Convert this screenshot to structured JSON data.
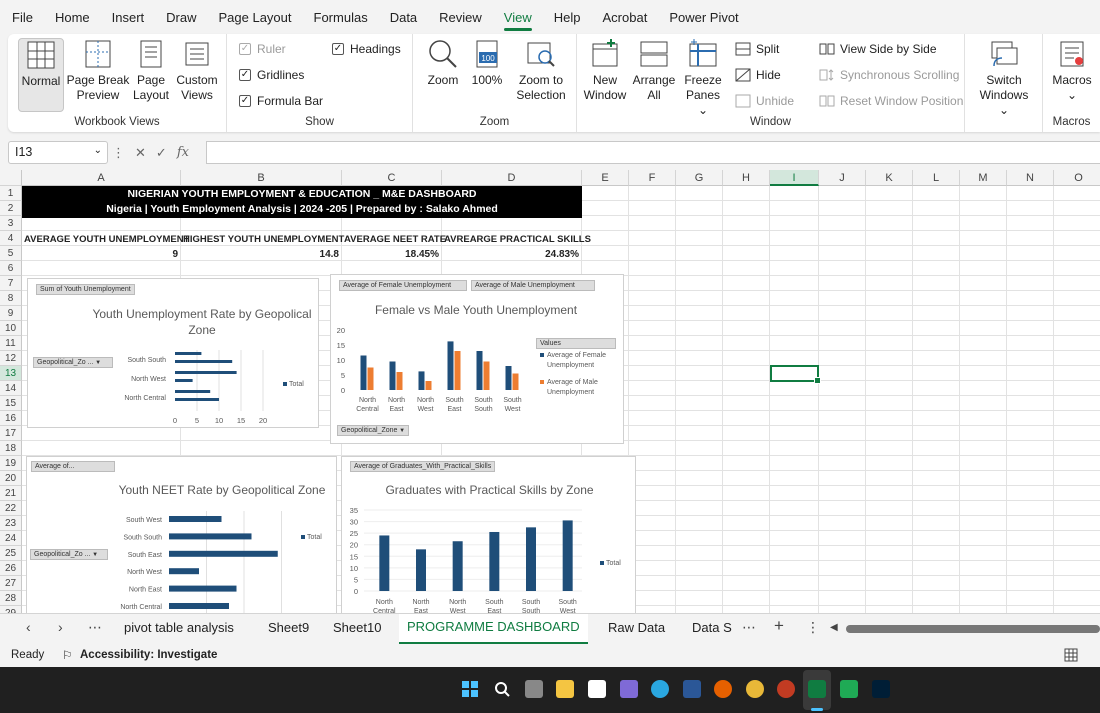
{
  "menu": [
    "File",
    "Home",
    "Insert",
    "Draw",
    "Page Layout",
    "Formulas",
    "Data",
    "Review",
    "View",
    "Help",
    "Acrobat",
    "Power Pivot"
  ],
  "active_menu": "View",
  "ribbon": {
    "workbook_views": {
      "label": "Workbook Views",
      "normal": "Normal",
      "page_break": [
        "Page Break",
        "Preview"
      ],
      "page_layout": [
        "Page",
        "Layout"
      ],
      "custom": [
        "Custom",
        "Views"
      ]
    },
    "show": {
      "label": "Show",
      "ruler": "Ruler",
      "gridlines": "Gridlines",
      "formula_bar": "Formula Bar",
      "headings": "Headings"
    },
    "zoom": {
      "label": "Zoom",
      "zoom": "Zoom",
      "hundred": "100%",
      "to_selection": [
        "Zoom to",
        "Selection"
      ],
      "icon_text": "100"
    },
    "window": {
      "label": "Window",
      "new_window": [
        "New",
        "Window"
      ],
      "arrange_all": [
        "Arrange",
        "All"
      ],
      "freeze": [
        "Freeze",
        "Panes ⌄"
      ],
      "split": "Split",
      "hide": "Hide",
      "unhide": "Unhide",
      "side_by_side": "View Side by Side",
      "sync_scroll": "Synchronous Scrolling",
      "reset_pos": "Reset Window Position",
      "switch": [
        "Switch",
        "Windows ⌄"
      ]
    },
    "macros": {
      "label": "Macros",
      "btn": "Macros",
      "arrow": "⌄"
    }
  },
  "namebox": "I13",
  "fx": "fx",
  "columns": [
    "A",
    "B",
    "C",
    "D",
    "E",
    "F",
    "G",
    "H",
    "I",
    "J",
    "K",
    "L",
    "M",
    "N",
    "O"
  ],
  "selected_column": "I",
  "rows": [
    "1",
    "2",
    "3",
    "4",
    "5",
    "6",
    "7",
    "8",
    "9",
    "10",
    "11",
    "12",
    "13",
    "14",
    "15",
    "16",
    "17",
    "18",
    "19",
    "20",
    "21",
    "22",
    "23",
    "24",
    "25",
    "26",
    "27",
    "28",
    "29"
  ],
  "selected_row": "13",
  "dashboard": {
    "title1": "NIGERIAN YOUTH EMPLOYMENT & EDUCATION _ M&E DASHBOARD",
    "title2": "Nigeria | Youth Employment Analysis | 2024 -205 | Prepared by : Salako Ahmed",
    "kpis": [
      {
        "label": "AVERAGE YOUTH UNEMPLOYMENT",
        "value": "9"
      },
      {
        "label": "HIGHEST YOUTH UNEMPLOYMENT",
        "value": "14.8"
      },
      {
        "label": "AVERAGE NEET RATE",
        "value": "18.45%"
      },
      {
        "label": "AVREARGE PRACTICAL SKILLS",
        "value": "24.83%"
      }
    ]
  },
  "chart_data": [
    {
      "type": "bar",
      "orientation": "horizontal",
      "title": "Youth Unemployment Rate by Geopolical Zone",
      "pivot_value_button": "Sum of Youth Unemployment",
      "pivot_field": "Geopolitical_Zo ...",
      "categories": [
        "South South",
        "North West",
        "North Central"
      ],
      "series": [
        {
          "name": "Total",
          "values": [
            13,
            4,
            10
          ]
        }
      ],
      "extra_bars": [
        6,
        14,
        8
      ],
      "xlim": [
        0,
        20
      ],
      "xticks": [
        "0",
        "5",
        "10",
        "15",
        "20"
      ],
      "legend": "right"
    },
    {
      "type": "bar",
      "orientation": "vertical",
      "title": "Female vs Male Youth Unemployment",
      "pivot_value_buttons": [
        "Average of Female Unemployment",
        "Average of Male Unemployment"
      ],
      "pivot_field": "Geopolitical_Zone",
      "legend_title": "Values",
      "categories": [
        [
          "North",
          "Central"
        ],
        [
          "North",
          "East"
        ],
        [
          "North",
          "West"
        ],
        [
          "South",
          "East"
        ],
        [
          "South",
          "South"
        ],
        [
          "South",
          "West"
        ]
      ],
      "series": [
        {
          "name": "Average of Female Unemployment",
          "values": [
            11.5,
            9.5,
            6.2,
            16.2,
            13,
            8
          ]
        },
        {
          "name": "Average of Male Unemployment",
          "values": [
            7.5,
            6,
            3,
            13,
            9.5,
            5.5
          ]
        }
      ],
      "ylim": [
        0,
        20
      ],
      "yticks": [
        "0",
        "5",
        "10",
        "15",
        "20"
      ],
      "colors": [
        "#1f4e79",
        "#ed7d31"
      ],
      "legend": "right"
    },
    {
      "type": "bar",
      "orientation": "horizontal",
      "title": "Youth NEET Rate by Geopolitical Zone",
      "pivot_value_button": "Average of...",
      "pivot_field": "Geopolitical_Zo ...",
      "categories": [
        "South West",
        "South South",
        "South East",
        "North West",
        "North East",
        "North Central"
      ],
      "series": [
        {
          "name": "Total",
          "values": [
            0.14,
            0.22,
            0.29,
            0.08,
            0.18,
            0.16
          ]
        }
      ],
      "legend": "right"
    },
    {
      "type": "bar",
      "orientation": "vertical",
      "title": "Graduates with Practical Skills by Zone",
      "pivot_value_button": "Average of Graduates_With_Practical_Skills",
      "categories": [
        [
          "North",
          "Central"
        ],
        [
          "North",
          "East"
        ],
        [
          "North",
          "West"
        ],
        [
          "South",
          "East"
        ],
        [
          "South",
          "South"
        ],
        [
          "South",
          "West"
        ]
      ],
      "series": [
        {
          "name": "Total",
          "values": [
            24,
            18,
            21.5,
            25.5,
            27.5,
            30.5
          ]
        }
      ],
      "ylim": [
        0,
        35
      ],
      "yticks": [
        "0",
        "5",
        "10",
        "15",
        "20",
        "25",
        "30",
        "35"
      ],
      "legend": "right"
    }
  ],
  "sheet_tabs": [
    "pivot table analysis",
    "Sheet9",
    "Sheet10",
    "PROGRAMME DASHBOARD",
    "Raw Data",
    "Data S"
  ],
  "active_tab": "PROGRAMME DASHBOARD",
  "status": {
    "ready": "Ready",
    "accessibility": "Accessibility: Investigate"
  },
  "colors": {
    "accent": "#107c41",
    "bar": "#1f4e79",
    "male": "#ed7d31"
  }
}
